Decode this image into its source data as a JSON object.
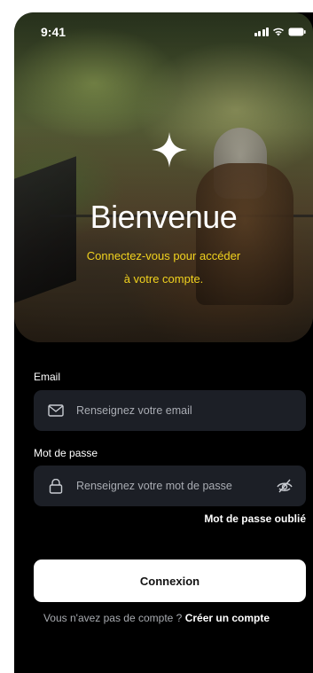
{
  "status_bar": {
    "time": "9:41"
  },
  "hero": {
    "title": "Bienvenue",
    "subtitle_line1": "Connectez-vous pour accéder",
    "subtitle_line2": "à votre compte."
  },
  "form": {
    "email_label": "Email",
    "email_placeholder": "Renseignez votre email",
    "password_label": "Mot de passe",
    "password_placeholder": "Renseignez votre mot de passe",
    "forgot_label": "Mot de passe oublié",
    "submit_label": "Connexion"
  },
  "footer": {
    "prompt": "Vous n'avez pas de compte ? ",
    "signup_link": "Créer un compte"
  },
  "colors": {
    "accent": "#f1d21e",
    "background": "#000000",
    "field_bg": "#1c1f26",
    "button_bg": "#ffffff"
  },
  "icons": {
    "email": "mail-icon",
    "password": "lock-icon",
    "toggle": "eye-off-icon",
    "logo": "sparkle-icon"
  }
}
